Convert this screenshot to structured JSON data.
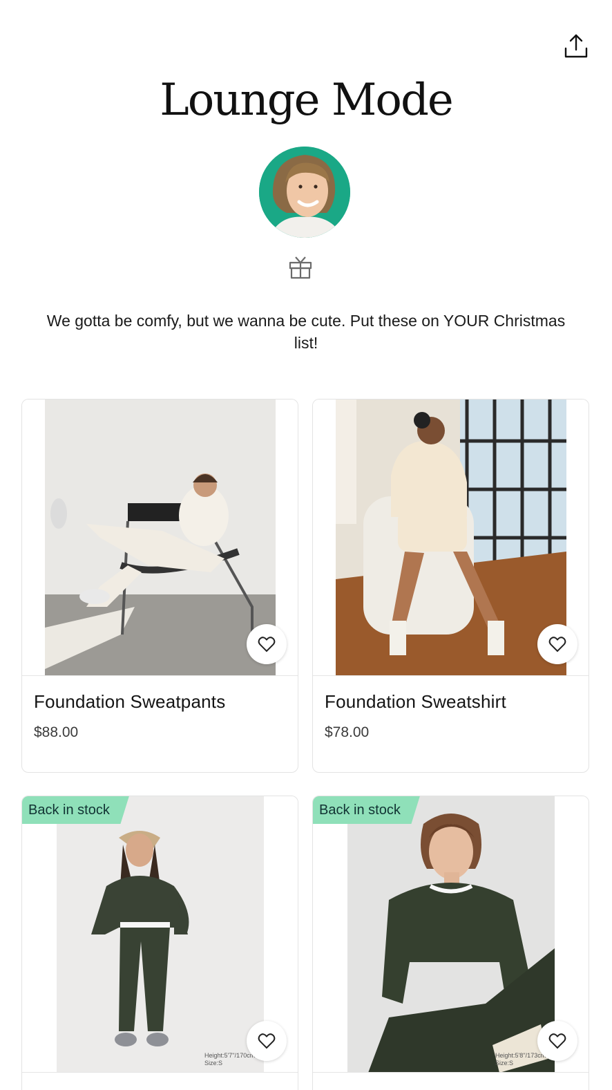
{
  "page": {
    "title": "Lounge Mode",
    "description": "We gotta be comfy, but we wanna be cute. Put these on YOUR Christmas list!"
  },
  "icons": {
    "share": "share-upload-icon",
    "gift": "gift-icon",
    "heart": "heart-outline-icon"
  },
  "colors": {
    "avatar_ring": "#1aa886",
    "badge": "#8fe0b9"
  },
  "products": [
    {
      "name": "Foundation Sweatpants",
      "price": "$88.00",
      "badge": ""
    },
    {
      "name": "Foundation Sweatshirt",
      "price": "$78.00",
      "badge": ""
    },
    {
      "name": "",
      "price": "",
      "badge": "Back in stock",
      "size_tag": "Height:5'7''/170cm\nSize:S"
    },
    {
      "name": "",
      "price": "",
      "badge": "Back in stock",
      "size_tag": "Height:5'8''/173cm\nSize:S"
    }
  ]
}
